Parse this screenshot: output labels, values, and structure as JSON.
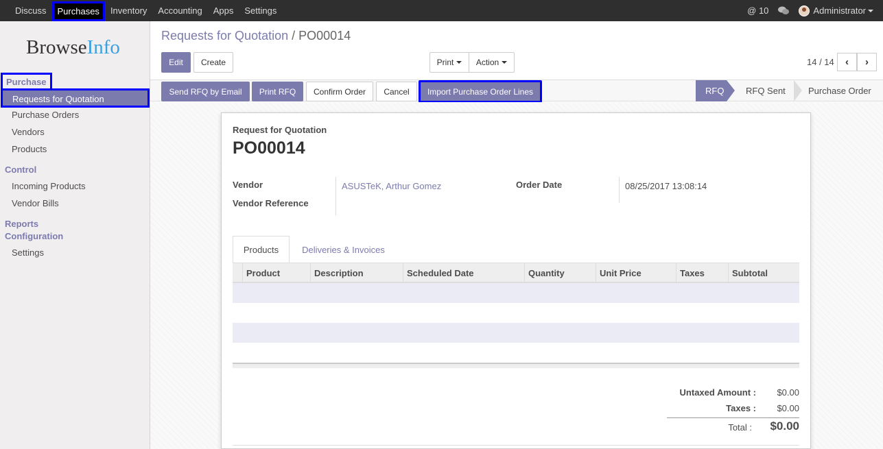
{
  "topbar": {
    "menu": [
      "Discuss",
      "Purchases",
      "Inventory",
      "Accounting",
      "Apps",
      "Settings"
    ],
    "active_menu": "Purchases",
    "notifications": "@ 10",
    "user": "Administrator"
  },
  "sidebar": {
    "logo_a": "Browse",
    "logo_b": "Info",
    "sections": [
      {
        "title": "Purchase",
        "items": [
          "Requests for Quotation",
          "Purchase Orders",
          "Vendors",
          "Products"
        ]
      },
      {
        "title": "Control",
        "items": [
          "Incoming Products",
          "Vendor Bills"
        ]
      },
      {
        "title": "Reports",
        "items": []
      },
      {
        "title": "Configuration",
        "items": [
          "Settings"
        ]
      }
    ]
  },
  "breadcrumb": {
    "parent": "Requests for Quotation",
    "separator": "/",
    "current": "PO00014"
  },
  "buttons": {
    "edit": "Edit",
    "create": "Create",
    "print": "Print",
    "action": "Action",
    "send_rfq": "Send RFQ by Email",
    "print_rfq": "Print RFQ",
    "confirm": "Confirm Order",
    "cancel": "Cancel",
    "import": "Import Purchase Order Lines"
  },
  "pager": {
    "text": "14 / 14",
    "prev": "‹",
    "next": "›"
  },
  "stages": [
    "RFQ",
    "RFQ Sent",
    "Purchase Order"
  ],
  "active_stage": "RFQ",
  "form": {
    "doc_type": "Request for Quotation",
    "name": "PO00014",
    "vendor_label": "Vendor",
    "vendor_value": "ASUSTeK, Arthur Gomez",
    "vendor_ref_label": "Vendor Reference",
    "order_date_label": "Order Date",
    "order_date_value": "08/25/2017 13:08:14"
  },
  "tabs": [
    "Products",
    "Deliveries & Invoices"
  ],
  "table": {
    "columns": [
      "Product",
      "Description",
      "Scheduled Date",
      "Quantity",
      "Unit Price",
      "Taxes",
      "Subtotal"
    ]
  },
  "totals": {
    "untaxed_label": "Untaxed Amount :",
    "untaxed_value": "$0.00",
    "taxes_label": "Taxes :",
    "taxes_value": "$0.00",
    "total_label": "Total :",
    "total_value": "$0.00"
  },
  "colors": {
    "accent": "#7c7bad",
    "highlight": "#0000ff",
    "topbar": "#2f2f2f"
  }
}
